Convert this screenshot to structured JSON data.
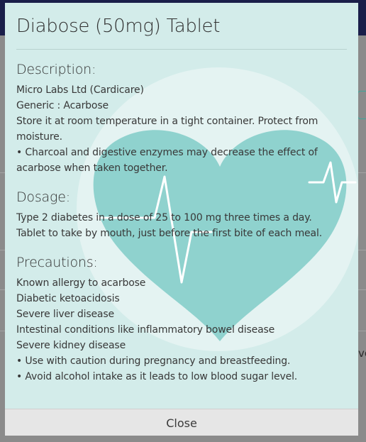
{
  "background": {
    "fragments": [
      "ve"
    ]
  },
  "modal": {
    "title": "Diabose (50mg) Tablet",
    "description": {
      "heading": "Description:",
      "lines": [
        "Micro Labs Ltd (Cardicare)",
        "Generic : Acarbose",
        "Store it at room temperature in a tight container. Protect from",
        "moisture.",
        "• Charcoal and digestive enzymes may decrease the effect of",
        "acarbose when taken together."
      ]
    },
    "dosage": {
      "heading": "Dosage:",
      "lines": [
        "Type 2 diabetes in a dose of 25 to 100 mg three times a day.",
        "Tablet to take by mouth, just before the first bite of each meal."
      ]
    },
    "precautions": {
      "heading": "Precautions:",
      "lines": [
        "Known allergy to acarbose",
        "Diabetic ketoacidosis",
        "Severe liver disease",
        "Intestinal conditions like inflammatory bowel disease",
        "Severe kidney disease",
        "• Use with caution during pregnancy and breastfeeding.",
        "• Avoid alcohol intake as it leads to low blood sugar level."
      ]
    },
    "close_label": "Close"
  },
  "colors": {
    "overlay": "#8b8b8b",
    "modal_bg": "#d3ecea",
    "heart": "#8fd2ce",
    "footer": "#e6e6e6",
    "topbar": "#1a1f4a"
  }
}
